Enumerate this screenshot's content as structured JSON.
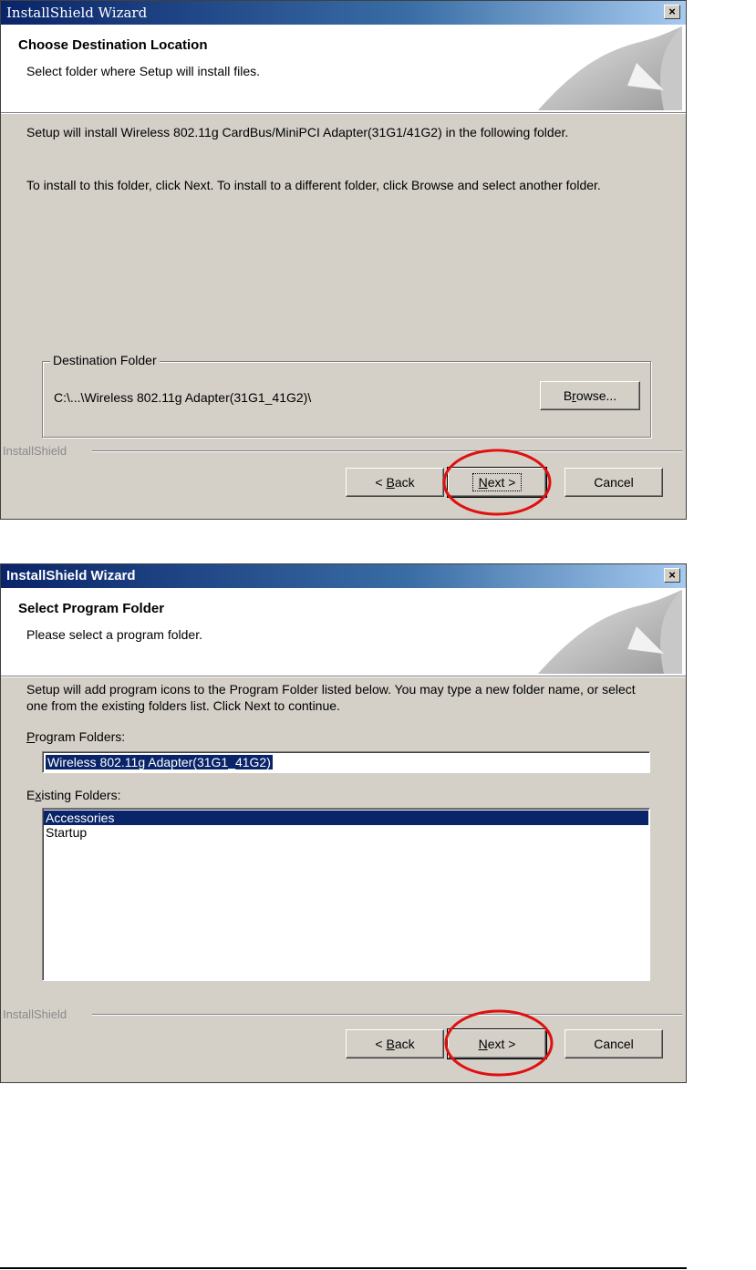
{
  "dialog1": {
    "title": "InstallShield Wizard",
    "close_label": "×",
    "header_title": "Choose Destination Location",
    "header_subtitle": "Select folder where Setup will install files.",
    "body_line1": "Setup will install Wireless 802.11g CardBus/MiniPCI Adapter(31G1/41G2) in the following folder.",
    "body_line2": "To install to this folder, click Next. To install to a different folder, click Browse and select another folder.",
    "group_label": "Destination Folder",
    "destination_path": "C:\\...\\Wireless 802.11g Adapter(31G1_41G2)\\",
    "browse_pre": "B",
    "browse_acc": "r",
    "browse_post": "owse...",
    "separator_label": "InstallShield",
    "back_pre": "< ",
    "back_acc": "B",
    "back_post": "ack",
    "next_acc": "N",
    "next_post": "ext >",
    "cancel_label": "Cancel"
  },
  "dialog2": {
    "title": "InstallShield Wizard",
    "close_label": "×",
    "header_title": "Select Program Folder",
    "header_subtitle": "Please select a program folder.",
    "body_line1": "Setup will add program icons to the Program Folder listed below.  You may type a new folder name, or select one from the existing folders list.  Click Next to continue.",
    "program_folders_acc": "P",
    "program_folders_post": "rogram Folders:",
    "program_folder_value": "Wireless 802.11g Adapter(31G1_41G2)",
    "existing_pre": "E",
    "existing_acc": "x",
    "existing_post": "isting Folders:",
    "existing_folders": [
      "Accessories",
      "Startup"
    ],
    "separator_label": "InstallShield",
    "back_pre": "< ",
    "back_acc": "B",
    "back_post": "ack",
    "next_acc": "N",
    "next_post": "ext >",
    "cancel_label": "Cancel"
  },
  "colors": {
    "title_gradient_start": "#0a246a",
    "title_gradient_end": "#a6caf0",
    "dialog_face": "#d4d0c8",
    "selection": "#0a246a",
    "highlight_circle": "#e01010"
  },
  "icons": [
    "close-icon",
    "page-curl-icon"
  ]
}
